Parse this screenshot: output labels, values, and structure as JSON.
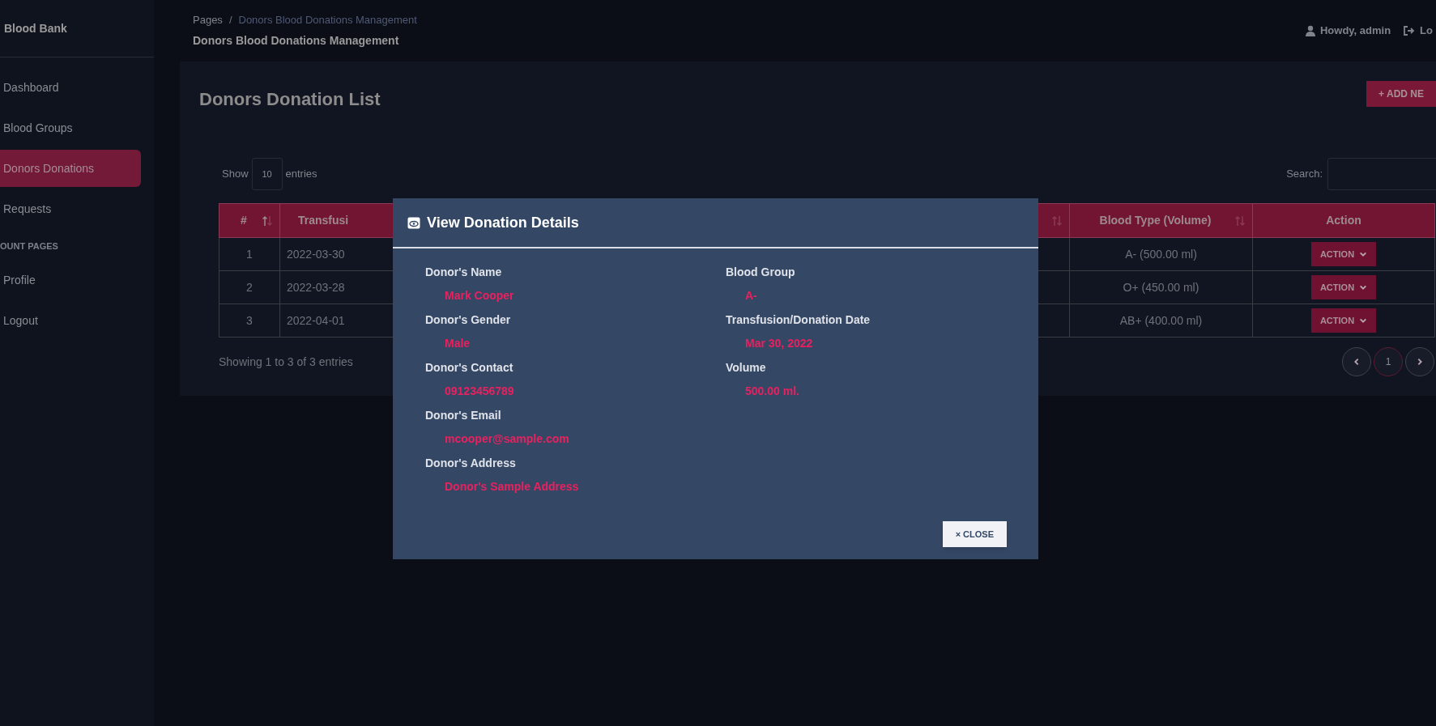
{
  "sidebar": {
    "brand": "Blood Bank",
    "items": [
      {
        "kind": "link",
        "label": "Dashboard",
        "selected": false
      },
      {
        "kind": "link",
        "label": "Blood Groups",
        "selected": false
      },
      {
        "kind": "link",
        "label": "Donors Donations",
        "selected": true
      },
      {
        "kind": "link",
        "label": "Requests",
        "selected": false
      },
      {
        "kind": "heading",
        "label": "OUNT PAGES"
      },
      {
        "kind": "link",
        "label": "Profile",
        "selected": false
      },
      {
        "kind": "link",
        "label": "Logout",
        "selected": false
      }
    ]
  },
  "header": {
    "breadcrumb": {
      "root": "Pages",
      "separator": "/",
      "current": "Donors Blood Donations Management"
    },
    "title": "Donors Blood Donations Management",
    "user": "Howdy, admin",
    "logout": "Lo"
  },
  "card": {
    "title": "Donors Donation List",
    "add_button": "+ ADD NE",
    "length": {
      "before": "Show",
      "value": "10",
      "after": "entries"
    },
    "search": {
      "label": "Search:"
    },
    "table": {
      "columns": [
        {
          "label": "#",
          "sortable": true
        },
        {
          "label": "Transfusi",
          "sortable": false
        },
        {
          "sortable": true
        },
        {
          "label": "Blood Type (Volume)",
          "sortable": true
        },
        {
          "label": "Action",
          "sortable": false
        }
      ],
      "rows": [
        {
          "number": "1",
          "date": "2022-03-30",
          "blood_type": "A- (500.00 ml)",
          "action": "ACTION"
        },
        {
          "number": "2",
          "date": "2022-03-28",
          "blood_type": "O+ (450.00 ml)",
          "action": "ACTION"
        },
        {
          "number": "3",
          "date": "2022-04-01",
          "blood_type": "AB+ (400.00 ml)",
          "action": "ACTION"
        }
      ]
    },
    "info": "Showing 1 to 3 of 3 entries",
    "pages": [
      {
        "label": "1",
        "selected": true
      }
    ]
  },
  "modal": {
    "title": "View Donation Details",
    "fields_left": [
      {
        "label": "Donor's Name",
        "value": "Mark Cooper"
      },
      {
        "label": "Donor's Gender",
        "value": "Male"
      },
      {
        "label": "Donor's Contact",
        "value": "09123456789"
      },
      {
        "label": "Donor's Email",
        "value": "mcooper@sample.com"
      },
      {
        "label": "Donor's Address",
        "value": "Donor's Sample Address"
      }
    ],
    "fields_right": [
      {
        "label": "Blood Group",
        "value": "A-"
      },
      {
        "label": "Transfusion/Donation Date",
        "value": "Mar 30, 2022"
      },
      {
        "label": "Volume",
        "value": "500.00 ml."
      }
    ],
    "close_button": "× CLOSE"
  }
}
